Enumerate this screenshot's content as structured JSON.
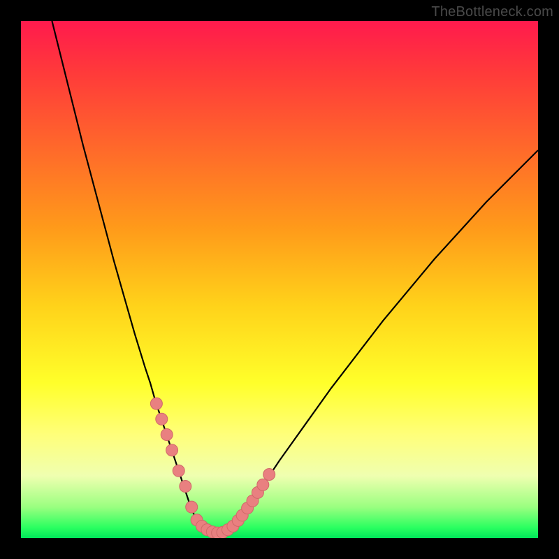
{
  "watermark": "TheBottleneck.com",
  "colors": {
    "background": "#000000",
    "gradient_top": "#ff1a4d",
    "gradient_bottom": "#00e65a",
    "curve": "#000000",
    "marker_fill": "#e98080",
    "marker_stroke": "#d06868"
  },
  "chart_data": {
    "type": "line",
    "title": "",
    "xlabel": "",
    "ylabel": "",
    "xlim": [
      0,
      100
    ],
    "ylim": [
      0,
      100
    ],
    "curve": {
      "name": "bottleneck-curve",
      "x": [
        6,
        8,
        10,
        12,
        14,
        16,
        18,
        20,
        22,
        24,
        25,
        26,
        27,
        28,
        29,
        30,
        31,
        32,
        33,
        34,
        35,
        36,
        37,
        38,
        39,
        40,
        42,
        44,
        46,
        50,
        55,
        60,
        65,
        70,
        75,
        80,
        85,
        90,
        95,
        100
      ],
      "y": [
        100,
        92,
        84,
        76,
        68.5,
        61,
        53.5,
        46.5,
        39.5,
        33,
        30,
        26.5,
        23.5,
        20.5,
        17.5,
        14.5,
        11.5,
        8.5,
        5.5,
        3.5,
        2.3,
        1.5,
        1.1,
        1.0,
        1.1,
        1.5,
        3.2,
        6.0,
        9.0,
        15.0,
        22.0,
        29.0,
        35.5,
        42.0,
        48.0,
        54.0,
        59.5,
        65.0,
        70.0,
        75.0
      ]
    },
    "markers": {
      "name": "highlight-points",
      "x": [
        26.2,
        27.2,
        28.2,
        29.2,
        30.5,
        31.8,
        33.0,
        34.0,
        35.0,
        36.0,
        37.0,
        38.0,
        39.0,
        40.0,
        41.0,
        42.0,
        42.8,
        43.8,
        44.8,
        45.8,
        46.8,
        48.0
      ],
      "y": [
        26.0,
        23.0,
        20.0,
        17.0,
        13.0,
        10.0,
        6.0,
        3.5,
        2.3,
        1.6,
        1.2,
        1.0,
        1.1,
        1.6,
        2.3,
        3.4,
        4.4,
        5.8,
        7.2,
        8.8,
        10.3,
        12.3
      ]
    }
  }
}
